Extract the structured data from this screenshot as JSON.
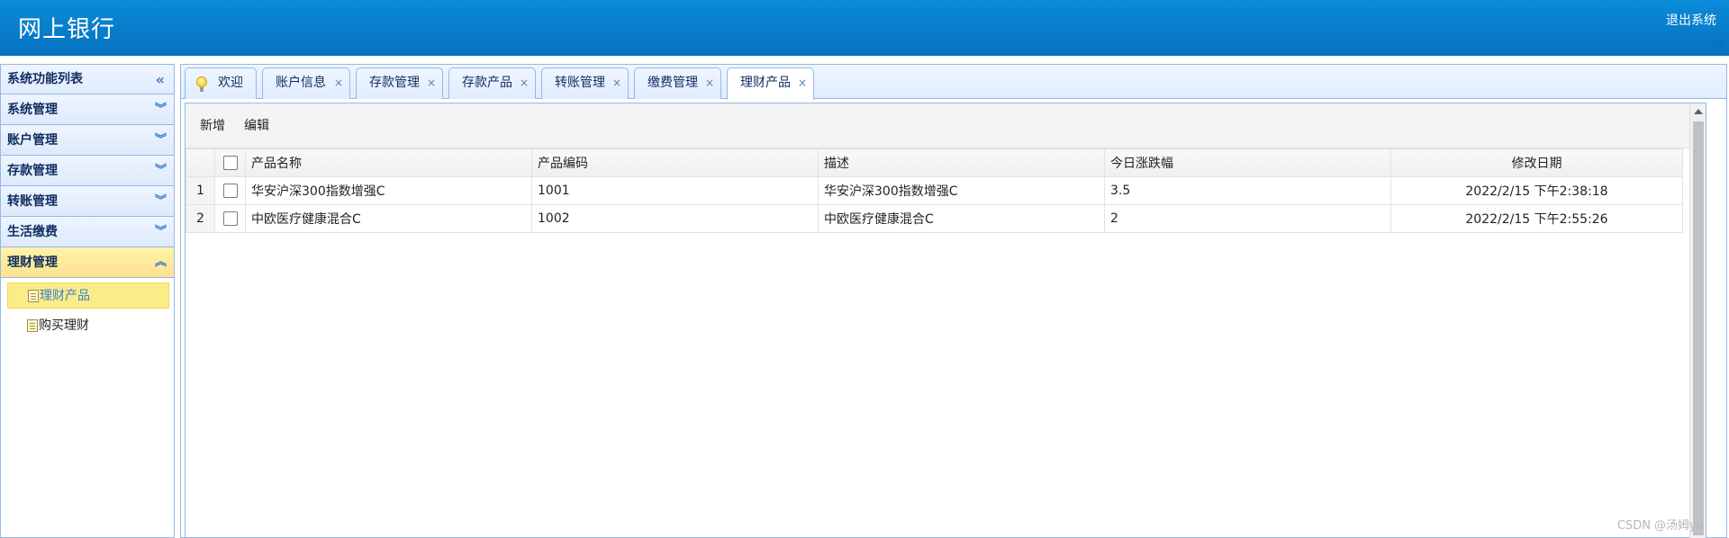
{
  "header": {
    "title": "网上银行",
    "logout": "退出系统"
  },
  "sidebar": {
    "title": "系统功能列表",
    "sections": [
      {
        "label": "系统管理"
      },
      {
        "label": "账户管理"
      },
      {
        "label": "存款管理"
      },
      {
        "label": "转账管理"
      },
      {
        "label": "生活缴费"
      },
      {
        "label": "理财管理",
        "active": true
      }
    ],
    "sub_items": [
      {
        "label": "理财产品",
        "selected": true
      },
      {
        "label": "购买理财"
      }
    ]
  },
  "tabs": [
    {
      "label": "欢迎",
      "icon": "lightbulb-icon"
    },
    {
      "label": "账户信息",
      "close": "×"
    },
    {
      "label": "存款管理",
      "close": "×"
    },
    {
      "label": "存款产品",
      "close": "×"
    },
    {
      "label": "转账管理",
      "close": "×"
    },
    {
      "label": "缴费管理",
      "close": "×"
    },
    {
      "label": "理财产品",
      "close": "×",
      "active": true
    }
  ],
  "toolbar": {
    "add_label": "新增",
    "edit_label": "编辑"
  },
  "grid": {
    "columns": [
      "产品名称",
      "产品编码",
      "描述",
      "今日涨跌幅",
      "修改日期"
    ],
    "rows": [
      {
        "num": "1",
        "name": "华安沪深300指数增强C",
        "code": "1001",
        "desc": "华安沪深300指数增强C",
        "change": "3.5",
        "date": "2022/2/15 下午2:38:18"
      },
      {
        "num": "2",
        "name": "中欧医疗健康混合C",
        "code": "1002",
        "desc": "中欧医疗健康混合C",
        "change": "2",
        "date": "2022/2/15 下午2:55:26"
      }
    ]
  },
  "watermark": "CSDN @汤姆yu",
  "colors": {
    "header": "#0a8bd8",
    "border": "#95b8e7",
    "active_section": "#fde28f"
  }
}
